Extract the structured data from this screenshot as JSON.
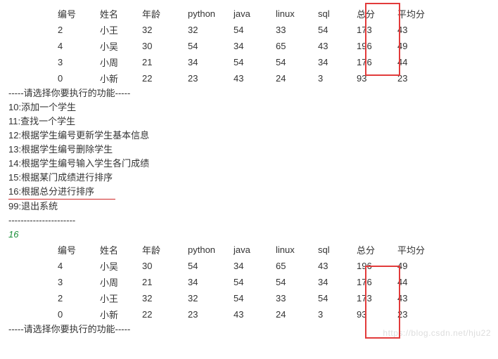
{
  "headers": {
    "id": "编号",
    "name": "姓名",
    "age": "年龄",
    "python": "python",
    "java": "java",
    "linux": "linux",
    "sql": "sql",
    "total": "总分",
    "avg": "平均分"
  },
  "table1_rows": [
    {
      "id": "2",
      "name": "小王",
      "age": "32",
      "python": "32",
      "java": "54",
      "linux": "33",
      "sql": "54",
      "total": "173",
      "avg": "43"
    },
    {
      "id": "4",
      "name": "小吴",
      "age": "30",
      "python": "54",
      "java": "34",
      "linux": "65",
      "sql": "43",
      "total": "196",
      "avg": "49"
    },
    {
      "id": "3",
      "name": "小周",
      "age": "21",
      "python": "34",
      "java": "54",
      "linux": "54",
      "sql": "34",
      "total": "176",
      "avg": "44"
    },
    {
      "id": "0",
      "name": "小新",
      "age": "22",
      "python": "23",
      "java": "43",
      "linux": "24",
      "sql": "3",
      "total": "93",
      "avg": "23"
    }
  ],
  "menu": {
    "title": "-----请选择你要执行的功能-----",
    "items": [
      "10:添加一个学生",
      "11:查找一个学生",
      "12:根据学生编号更新学生基本信息",
      "13:根据学生编号删除学生",
      "14:根据学生编号输入学生各门成绩",
      "15:根据某门成绩进行排序",
      "16:根据总分进行排序",
      "99:退出系统"
    ],
    "divider": "----------------------"
  },
  "input_value": "16",
  "table2_rows": [
    {
      "id": "4",
      "name": "小吴",
      "age": "30",
      "python": "54",
      "java": "34",
      "linux": "65",
      "sql": "43",
      "total": "196",
      "avg": "49"
    },
    {
      "id": "3",
      "name": "小周",
      "age": "21",
      "python": "34",
      "java": "54",
      "linux": "54",
      "sql": "34",
      "total": "176",
      "avg": "44"
    },
    {
      "id": "2",
      "name": "小王",
      "age": "32",
      "python": "32",
      "java": "54",
      "linux": "33",
      "sql": "54",
      "total": "173",
      "avg": "43"
    },
    {
      "id": "0",
      "name": "小新",
      "age": "22",
      "python": "23",
      "java": "43",
      "linux": "24",
      "sql": "3",
      "total": "93",
      "avg": "23"
    }
  ],
  "footer_prompt": "-----请选择你要执行的功能-----",
  "watermark": "https://blog.csdn.net/hju22"
}
